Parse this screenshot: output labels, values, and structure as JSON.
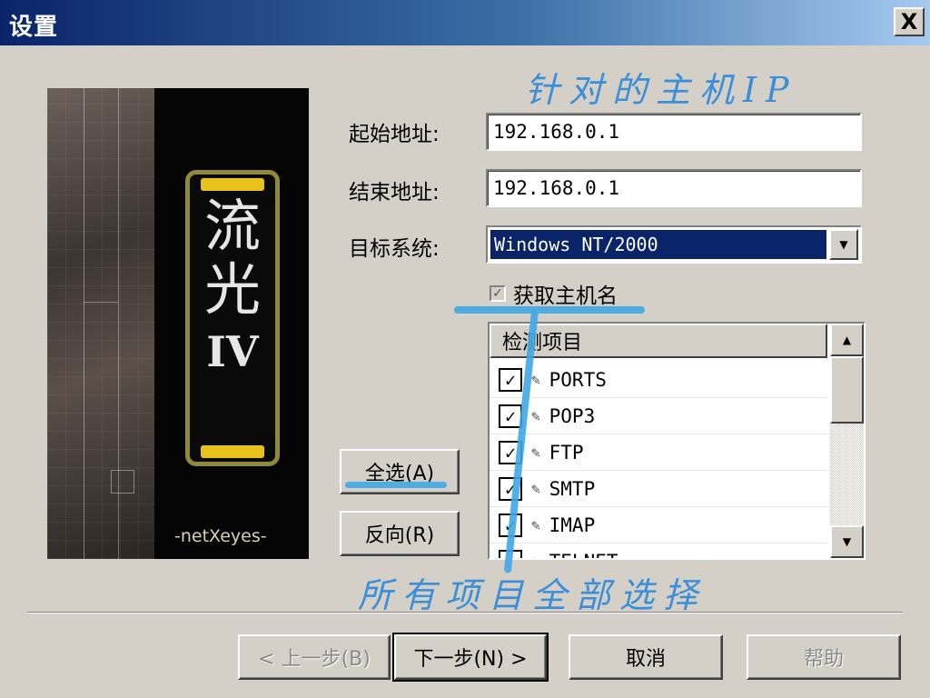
{
  "window": {
    "title": "设置",
    "close_label": "X"
  },
  "banner": {
    "char1": "流",
    "char2": "光",
    "version": "IV",
    "brand": "-netXeyes-"
  },
  "form": {
    "start_label": "起始地址:",
    "start_value": "192.168.0.1",
    "end_label": "结束地址:",
    "end_value": "192.168.0.1",
    "target_label": "目标系统:",
    "target_value": "Windows NT/2000",
    "get_hostname_label": "获取主机名",
    "get_hostname_checked": true
  },
  "list": {
    "header": "检测项目",
    "items": [
      {
        "label": "PORTS",
        "checked": true
      },
      {
        "label": "POP3",
        "checked": true
      },
      {
        "label": "FTP",
        "checked": true
      },
      {
        "label": "SMTP",
        "checked": true
      },
      {
        "label": "IMAP",
        "checked": true
      },
      {
        "label": "TELNET",
        "checked": true
      }
    ]
  },
  "side_buttons": {
    "select_all": "全选(A)",
    "invert": "反向(R)"
  },
  "footer": {
    "back": "< 上一步(B)",
    "next": "下一步(N) >",
    "cancel": "取消",
    "help": "帮助"
  },
  "annotations": {
    "top": "针对的主机IP",
    "bottom": "所有项目全部选择"
  },
  "colors": {
    "titlebar": "#0a246a",
    "selection": "#0a246a",
    "face": "#d4d0c8",
    "annotation": "#3a8fd8",
    "logo_accent": "#e8c21a"
  }
}
